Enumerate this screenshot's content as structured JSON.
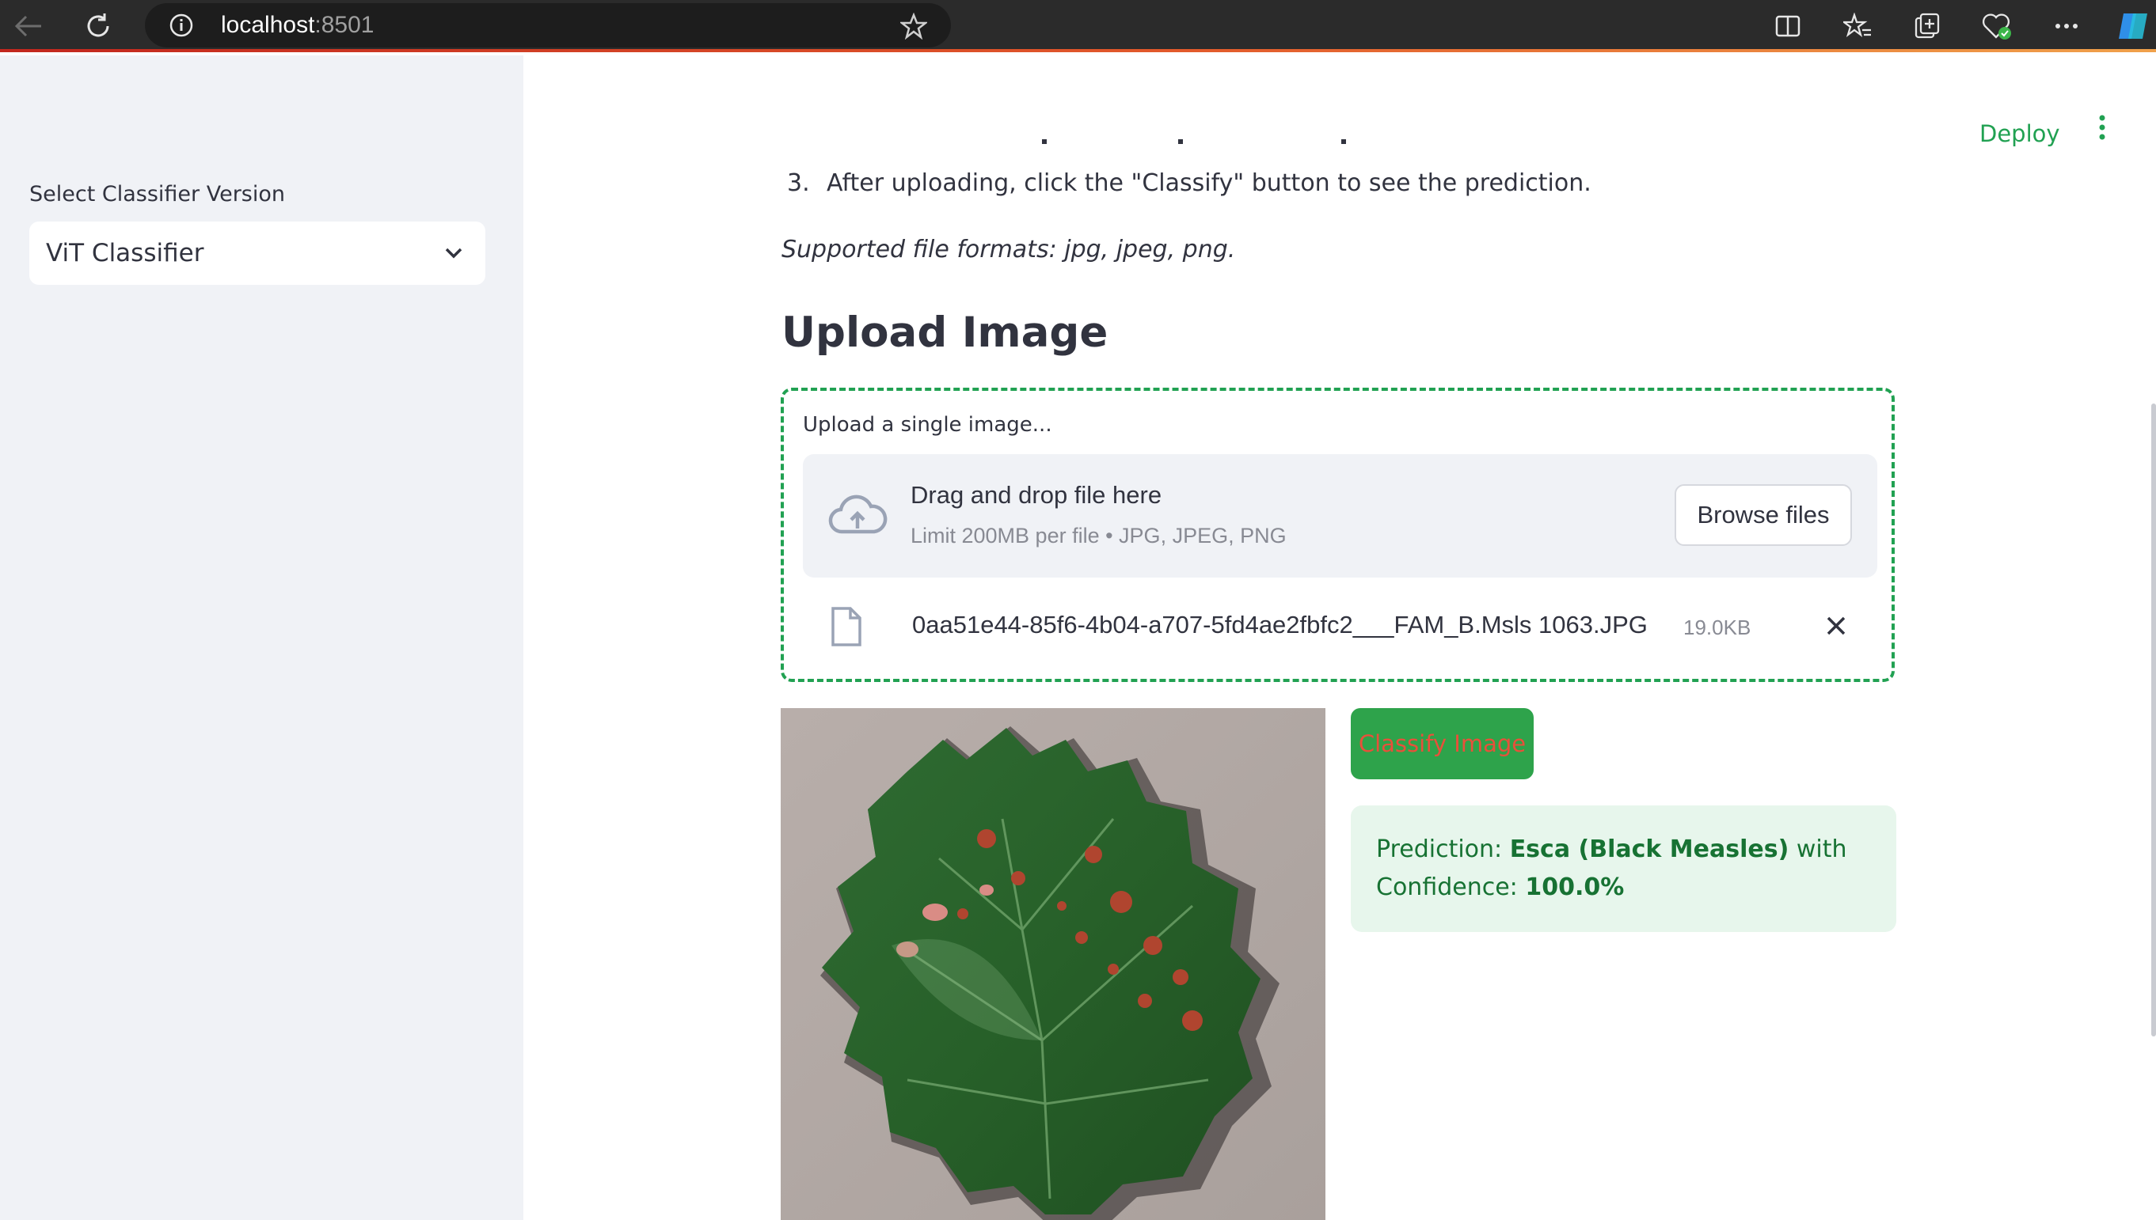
{
  "browser": {
    "url_host": "localhost",
    "url_port": ":8501",
    "icons": [
      "back-arrow-icon",
      "reload-icon",
      "info-icon",
      "favorite-star-icon",
      "split-screen-icon",
      "favorites-icon",
      "collections-icon",
      "browser-essentials-icon",
      "more-icon",
      "copilot-icon"
    ]
  },
  "sidebar": {
    "select_label": "Select Classifier Version",
    "select_value": "ViT Classifier"
  },
  "header": {
    "deploy_label": "Deploy"
  },
  "instructions": {
    "step_number": "3.",
    "step_text": "After uploading, click the \"Classify\" button to see the prediction.",
    "formats_text": "Supported file formats: jpg, jpeg, png."
  },
  "upload": {
    "heading": "Upload Image",
    "label": "Upload a single image...",
    "drop_title": "Drag and drop file here",
    "drop_sub": "Limit 200MB per file • JPG, JPEG, PNG",
    "browse_label": "Browse files",
    "file_name": "0aa51e44-85f6-4b04-a707-5fd4ae2fbfc2___FAM_B.Msls 1063.JPG",
    "file_size": "19.0KB"
  },
  "classify": {
    "button_label": "Classify Image"
  },
  "prediction": {
    "prefix": "Prediction: ",
    "label": "Esca (Black Measles)",
    "middle": " with",
    "conf_prefix": "Confidence: ",
    "confidence": "100.0%"
  },
  "colors": {
    "accent_green": "#21a152",
    "sidebar_bg": "#f0f2f6",
    "text": "#31333f",
    "success_bg": "#e7f6ec",
    "success_text": "#177233"
  }
}
